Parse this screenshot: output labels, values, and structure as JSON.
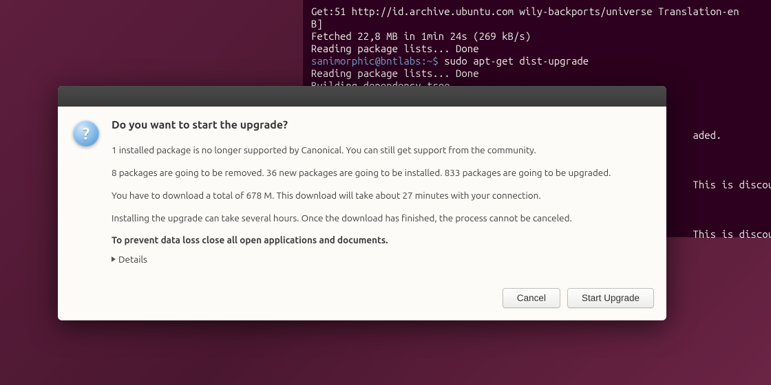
{
  "terminal": {
    "lines": {
      "l1": "Get:51 http://id.archive.ubuntu.com wily-backports/universe Translation-en",
      "l2": "B]",
      "l3": "Fetched 22,8 MB in 1min 24s (269 kB/s)",
      "l4": "Reading package lists... Done",
      "l5_prompt": "sanimorphic@bntlabs:~$ ",
      "l5_cmd": "sudo apt-get dist-upgrade",
      "l6": "Reading package lists... Done",
      "l7": "Building dependency tree",
      "l8_tail": "aded.",
      "l9_tail": " This is discoura",
      "l10_tail": " This is discoura"
    }
  },
  "dialog": {
    "heading": "Do you want to start the upgrade?",
    "p1": "1 installed package is no longer supported by Canonical. You can still get support from the community.",
    "p2": "8 packages are going to be removed. 36 new packages are going to be installed. 833 packages are going to be upgraded.",
    "p3": "You have to download a total of 678 M. This download will take about 27 minutes with your connection.",
    "p4": "Installing the upgrade can take several hours. Once the download has finished, the process cannot be canceled.",
    "warn": "To prevent data loss close all open applications and documents.",
    "details_label": "Details",
    "cancel": "Cancel",
    "start": "Start Upgrade",
    "icon_glyph": "?"
  }
}
